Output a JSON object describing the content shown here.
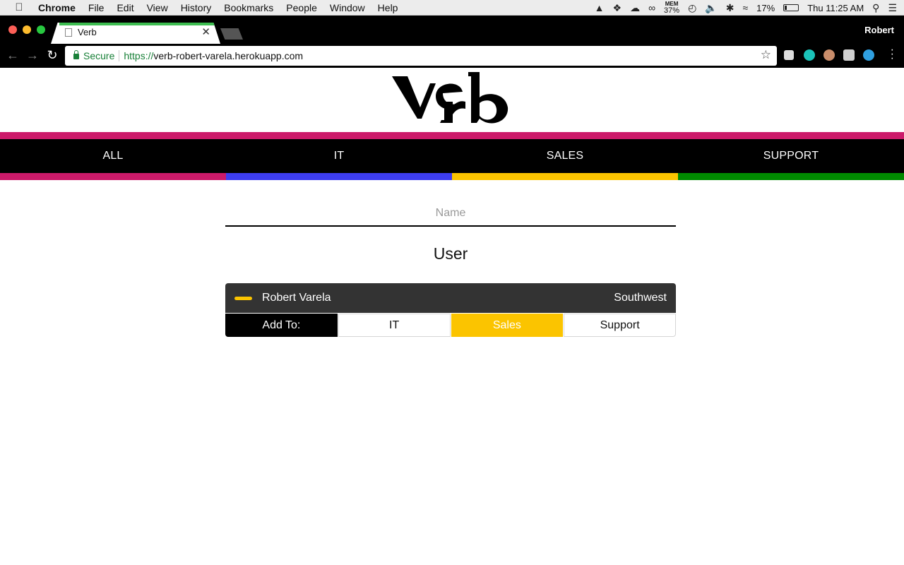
{
  "menubar": {
    "app": "Chrome",
    "items": [
      "File",
      "Edit",
      "View",
      "History",
      "Bookmarks",
      "People",
      "Window",
      "Help"
    ],
    "mem_label": "MEM",
    "mem_pct": "37%",
    "battery_pct": "17%",
    "battery_level": 0.17,
    "clock": "Thu 11:25 AM"
  },
  "browser": {
    "tab_title": "Verb",
    "profile": "Robert",
    "secure_label": "Secure",
    "url_scheme": "https://",
    "url_host": "verb-robert-varela.herokuapp.com"
  },
  "site": {
    "logo_text": "verb",
    "brand_color": "#cc1a6a",
    "nav": [
      {
        "label": "ALL",
        "color": "#cc1a6a"
      },
      {
        "label": "IT",
        "color": "#3d3df0"
      },
      {
        "label": "SALES",
        "color": "#fbc400"
      },
      {
        "label": "SUPPORT",
        "color": "#008a00"
      }
    ],
    "name_placeholder": "Name",
    "section_title": "User"
  },
  "user": {
    "name": "Robert Varela",
    "region": "Southwest",
    "marker_color": "#fbc400",
    "add_to_label": "Add To:",
    "options": [
      "IT",
      "Sales",
      "Support"
    ],
    "selected": "Sales"
  }
}
